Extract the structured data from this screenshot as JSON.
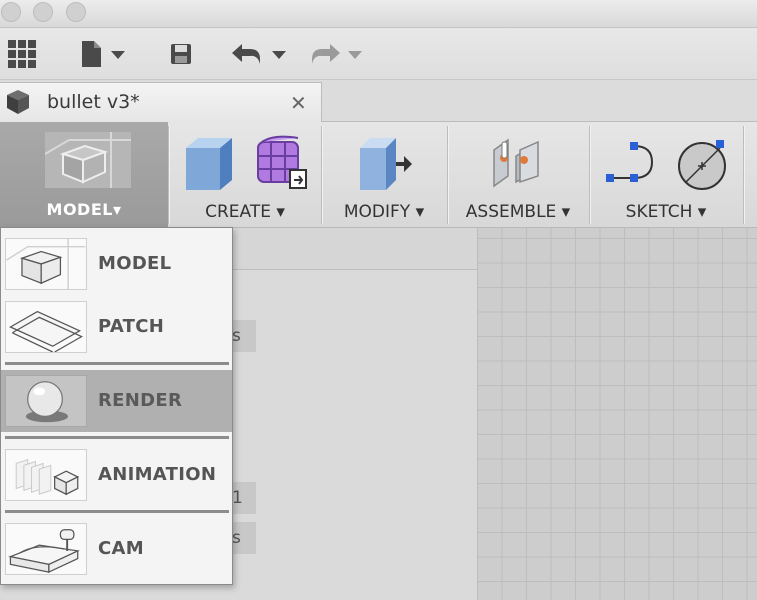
{
  "document": {
    "tab_title": "bullet v3*",
    "close_glyph": "✕"
  },
  "ribbon": {
    "workspace_label": "MODEL▾",
    "groups": [
      {
        "label": "CREATE ▾"
      },
      {
        "label": "MODIFY ▾"
      },
      {
        "label": "ASSEMBLE ▾"
      },
      {
        "label": "SKETCH ▾"
      }
    ]
  },
  "browser": {
    "chip_1": "s",
    "chip_2": "1",
    "chip_3": "s"
  },
  "workspace_menu": {
    "items": [
      {
        "label": "MODEL",
        "icon": "model-workspace-icon"
      },
      {
        "label": "PATCH",
        "icon": "patch-workspace-icon"
      },
      {
        "label": "RENDER",
        "icon": "render-workspace-icon",
        "highlighted": true
      },
      {
        "label": "ANIMATION",
        "icon": "animation-workspace-icon"
      },
      {
        "label": "CAM",
        "icon": "cam-workspace-icon"
      }
    ]
  },
  "colors": {
    "workspace_button": "#a0a0a0",
    "menu_highlight": "#b0b0b0",
    "cube_blue": "#7fa8d8",
    "mesh_purple": "#b07ae0",
    "sketch_blue": "#2b5fd6"
  }
}
